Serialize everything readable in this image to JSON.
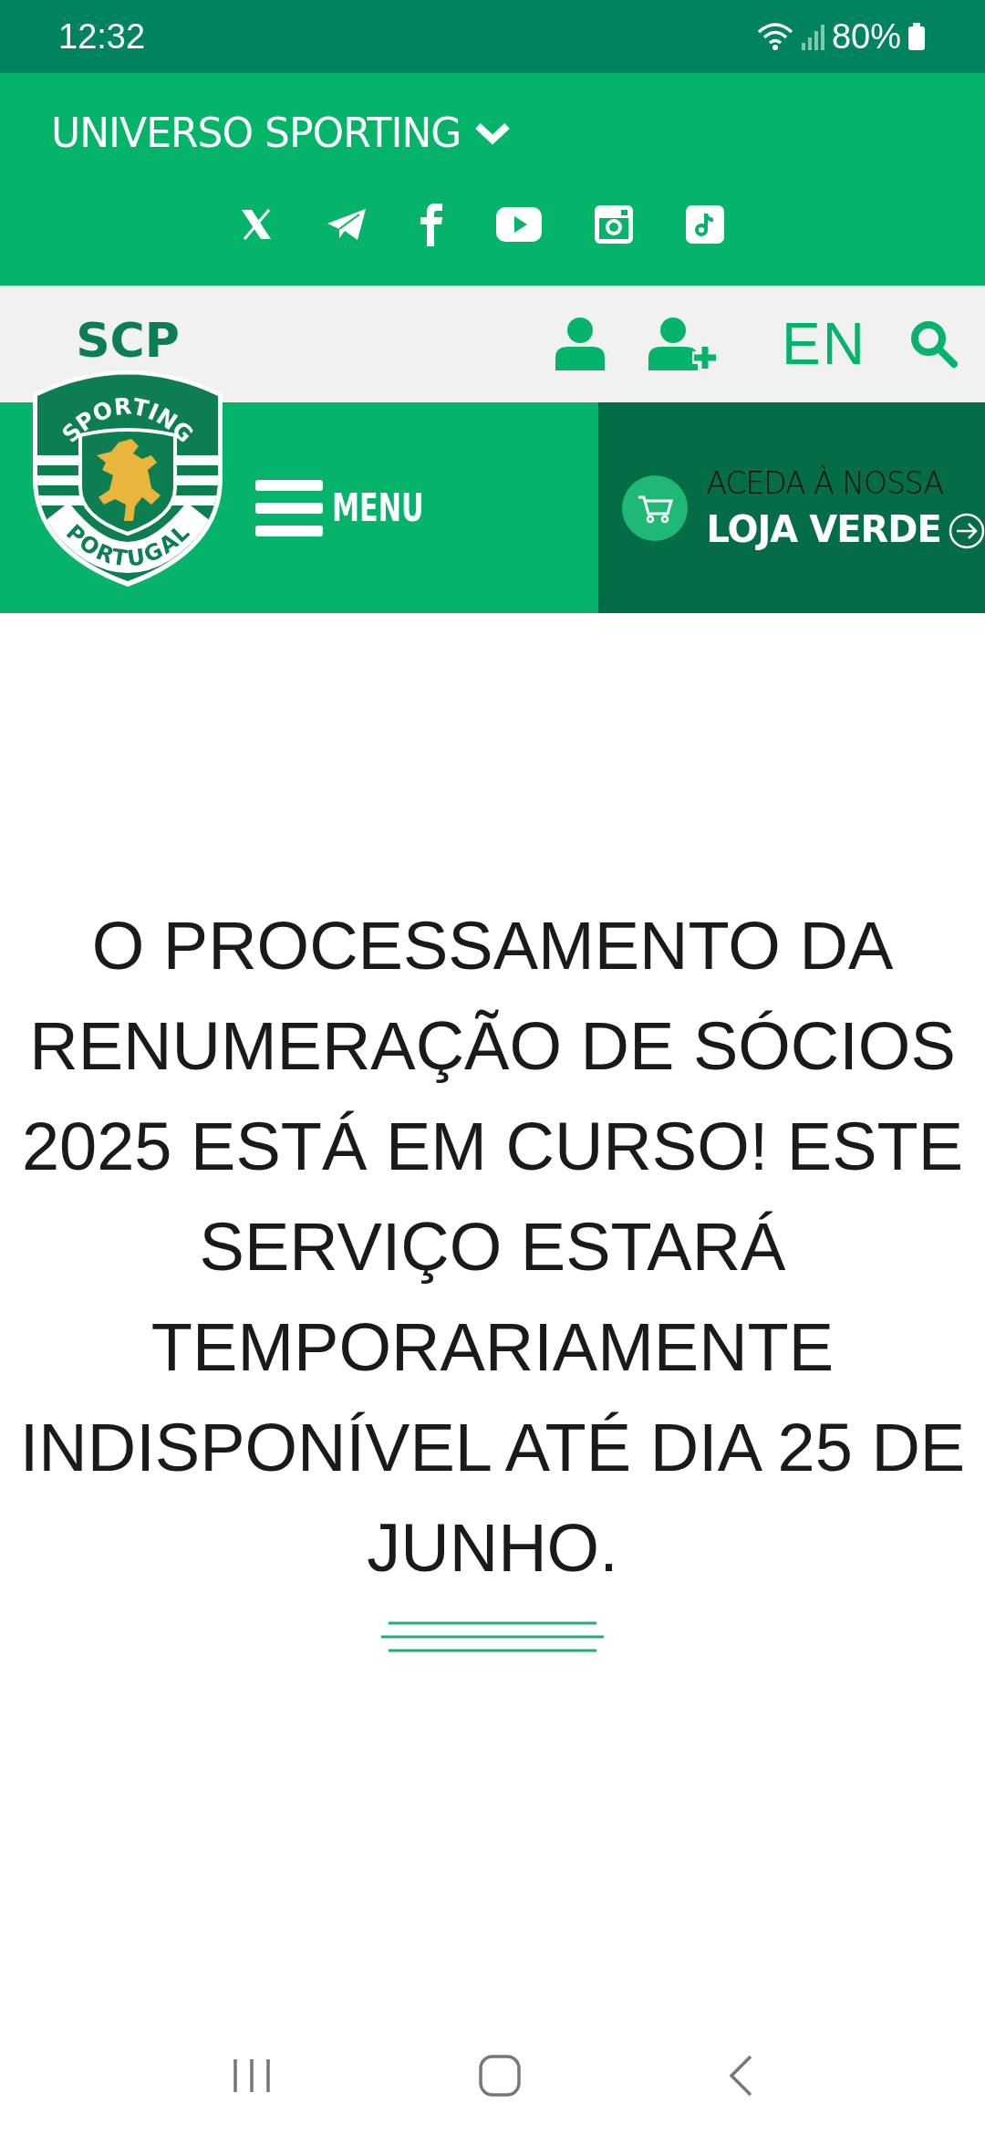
{
  "status_bar": {
    "time": "12:32",
    "battery": "80%"
  },
  "top_bar": {
    "menu_title": "UNIVERSO SPORTING",
    "social_links": [
      {
        "kind": "x"
      },
      {
        "kind": "telegram"
      },
      {
        "kind": "facebook"
      },
      {
        "kind": "youtube"
      },
      {
        "kind": "instagram"
      },
      {
        "kind": "tiktok"
      }
    ]
  },
  "header": {
    "logo": {
      "initials": "SCP",
      "top_arc": "SPORTING",
      "bottom_arc": "PORTUGAL"
    },
    "language": "EN",
    "menu_label": "MENU",
    "shop": {
      "kicker": "ACEDA À NOSSA",
      "title": "LOJA VERDE"
    }
  },
  "notice": {
    "text": "O PROCESSAMENTO DA RENUMERAÇÃO DE SÓCIOS 2025 ESTÁ EM CURSO! ESTE SERVIÇO ESTARÁ TEMPORARIAMENTE INDISPONÍVEL ATÉ DIA 25 DE JUNHO."
  }
}
